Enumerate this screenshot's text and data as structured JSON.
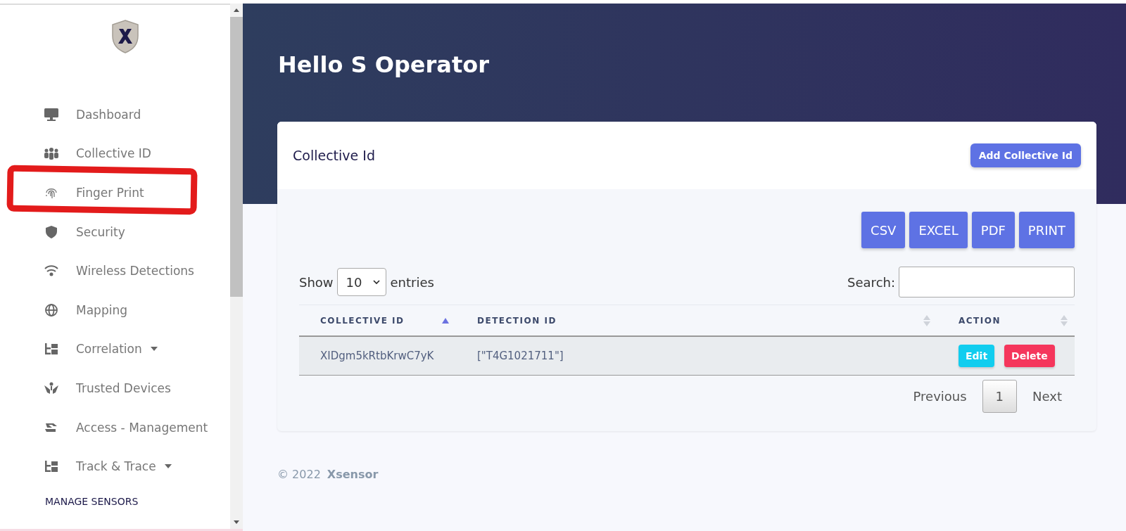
{
  "sidebar": {
    "items": [
      {
        "label": "Dashboard",
        "expandable": false
      },
      {
        "label": "Collective ID",
        "expandable": false
      },
      {
        "label": "Finger Print",
        "expandable": false
      },
      {
        "label": "Security",
        "expandable": false
      },
      {
        "label": "Wireless Detections",
        "expandable": false
      },
      {
        "label": "Mapping",
        "expandable": false
      },
      {
        "label": "Correlation",
        "expandable": true
      },
      {
        "label": "Trusted Devices",
        "expandable": false
      },
      {
        "label": "Access - Management",
        "expandable": false
      },
      {
        "label": "Track & Trace",
        "expandable": true
      }
    ],
    "section_heading": "MANAGE SENSORS"
  },
  "header": {
    "greeting": "Hello S Operator"
  },
  "card": {
    "title": "Collective Id",
    "add_button": "Add Collective Id",
    "export_buttons": [
      "CSV",
      "EXCEL",
      "PDF",
      "PRINT"
    ],
    "length": {
      "show_label": "Show",
      "value": "10",
      "entries_label": "entries"
    },
    "search": {
      "label": "Search:"
    },
    "table": {
      "columns": [
        {
          "label": "COLLECTIVE ID",
          "sorted": true
        },
        {
          "label": "DETECTION ID",
          "sorted": false
        },
        {
          "label": "ACTION",
          "sorted": false
        }
      ],
      "rows": [
        {
          "cells": [
            "XIDgm5kRtbKrwC7yK",
            "[\"T4G1021711\"]"
          ],
          "actions": [
            {
              "label": "Edit",
              "kind": "edit"
            },
            {
              "label": "Delete",
              "kind": "delete"
            }
          ]
        }
      ]
    },
    "pagination": {
      "previous": "Previous",
      "pages": [
        {
          "label": "1",
          "selected": true
        }
      ],
      "next": "Next"
    }
  },
  "footer": {
    "copyright": "© 2022",
    "brand": "Xsensor"
  }
}
